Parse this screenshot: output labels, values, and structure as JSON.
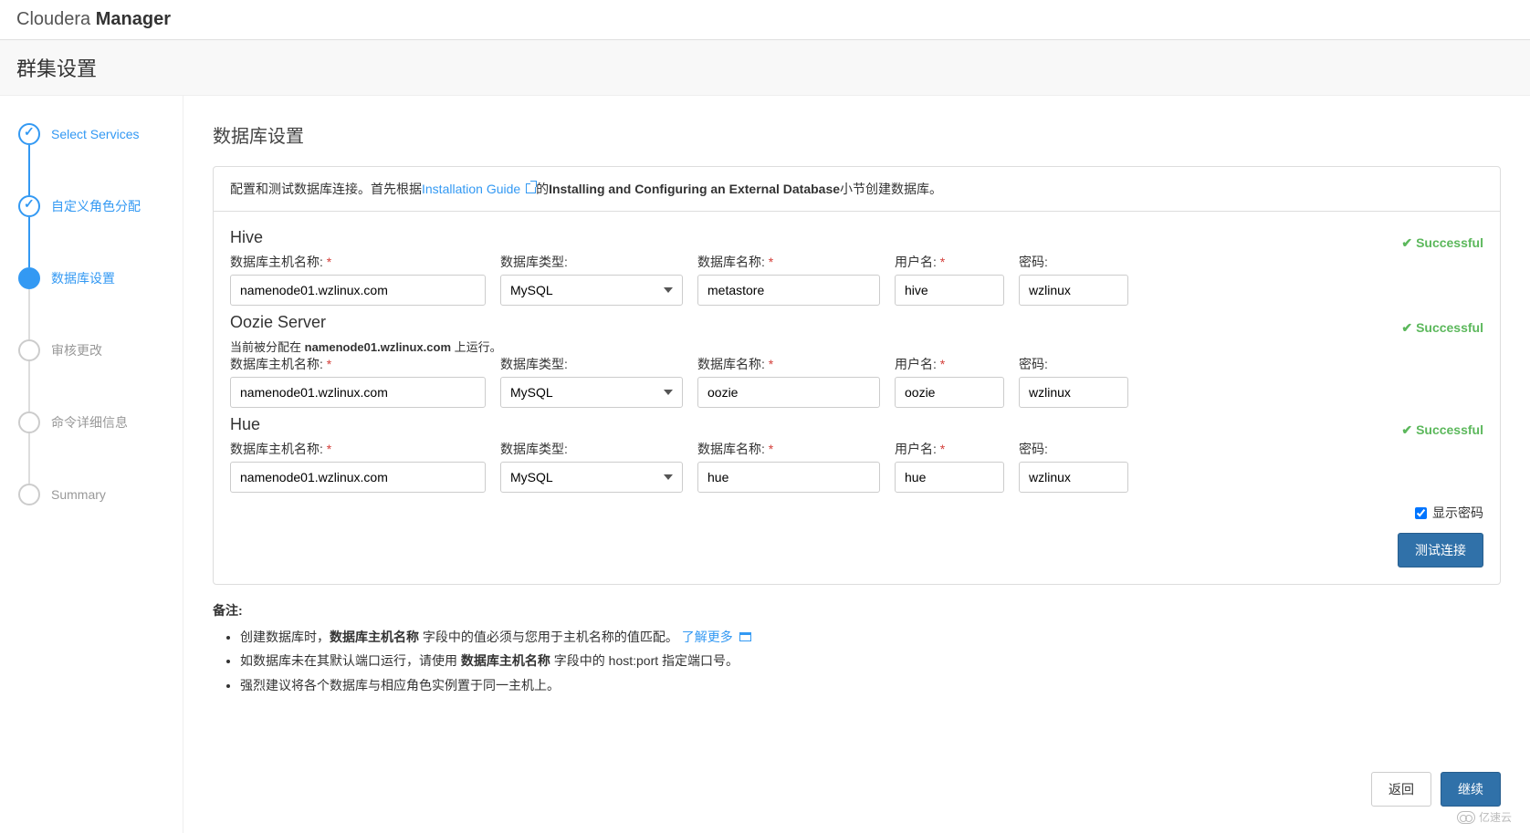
{
  "brand": {
    "light": "Cloudera",
    "bold": "Manager"
  },
  "subtitle": "群集设置",
  "steps": [
    {
      "label": "Select Services",
      "state": "done"
    },
    {
      "label": "自定义角色分配",
      "state": "done"
    },
    {
      "label": "数据库设置",
      "state": "active"
    },
    {
      "label": "审核更改",
      "state": "pending"
    },
    {
      "label": "命令详细信息",
      "state": "pending"
    },
    {
      "label": "Summary",
      "state": "pending"
    }
  ],
  "page_title": "数据库设置",
  "info": {
    "prefix": "配置和测试数据库连接。首先根据",
    "link": "Installation Guide",
    "mid": "的",
    "bold": "Installing and Configuring an External Database",
    "suffix": "小节创建数据库。"
  },
  "labels": {
    "host": "数据库主机名称:",
    "type": "数据库类型:",
    "name": "数据库名称:",
    "user": "用户名:",
    "pass": "密码:",
    "success": "Successful",
    "show_password": "显示密码",
    "test_connection": "测试连接",
    "back": "返回",
    "continue": "继续"
  },
  "sections": [
    {
      "title": "Hive",
      "host": "namenode01.wzlinux.com",
      "type": "MySQL",
      "dbname": "metastore",
      "user": "hive",
      "pass": "wzlinux",
      "assigned_prefix": null
    },
    {
      "title": "Oozie Server",
      "host": "namenode01.wzlinux.com",
      "type": "MySQL",
      "dbname": "oozie",
      "user": "oozie",
      "pass": "wzlinux",
      "assigned_prefix": "当前被分配在 ",
      "assigned_host": "namenode01.wzlinux.com",
      "assigned_suffix": " 上运行。"
    },
    {
      "title": "Hue",
      "host": "namenode01.wzlinux.com",
      "type": "MySQL",
      "dbname": "hue",
      "user": "hue",
      "pass": "wzlinux",
      "assigned_prefix": null
    }
  ],
  "notes": {
    "title": "备注:",
    "items": [
      {
        "p1": "创建数据库时，",
        "b1": "数据库主机名称",
        "p2": " 字段中的值必须与您用于主机名称的值匹配。 ",
        "link": "了解更多"
      },
      {
        "p1": "如数据库未在其默认端口运行，请使用 ",
        "b1": "数据库主机名称",
        "p2": " 字段中的 host:port 指定端口号。"
      },
      {
        "p1": "强烈建议将各个数据库与相应角色实例置于同一主机上。"
      }
    ]
  },
  "watermark": "亿速云"
}
